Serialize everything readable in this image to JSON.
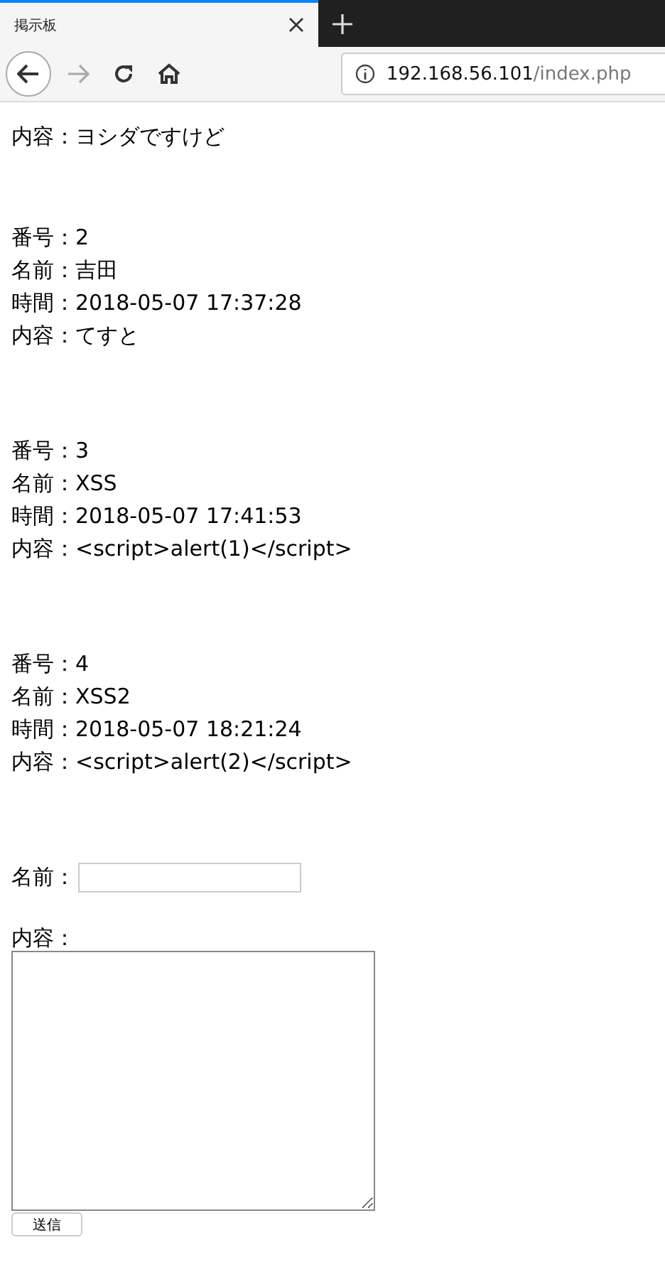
{
  "browser": {
    "tab_title": "掲示板",
    "url_host": "192.168.56.101",
    "url_path": "/index.php"
  },
  "posts": [
    {
      "lines": [
        "内容：ヨシダですけど"
      ]
    },
    {
      "lines": [
        "番号：2",
        "名前：吉田",
        "時間：2018-05-07 17:37:28",
        "内容：てすと"
      ]
    },
    {
      "lines": [
        "番号：3",
        "名前：XSS",
        "時間：2018-05-07 17:41:53",
        "内容：<script>alert(1)</script>"
      ]
    },
    {
      "lines": [
        "番号：4",
        "名前：XSS2",
        "時間：2018-05-07 18:21:24",
        "内容：<script>alert(2)</script>"
      ]
    }
  ],
  "form": {
    "name_label": "名前：",
    "content_label": "内容：",
    "submit": "送信"
  }
}
